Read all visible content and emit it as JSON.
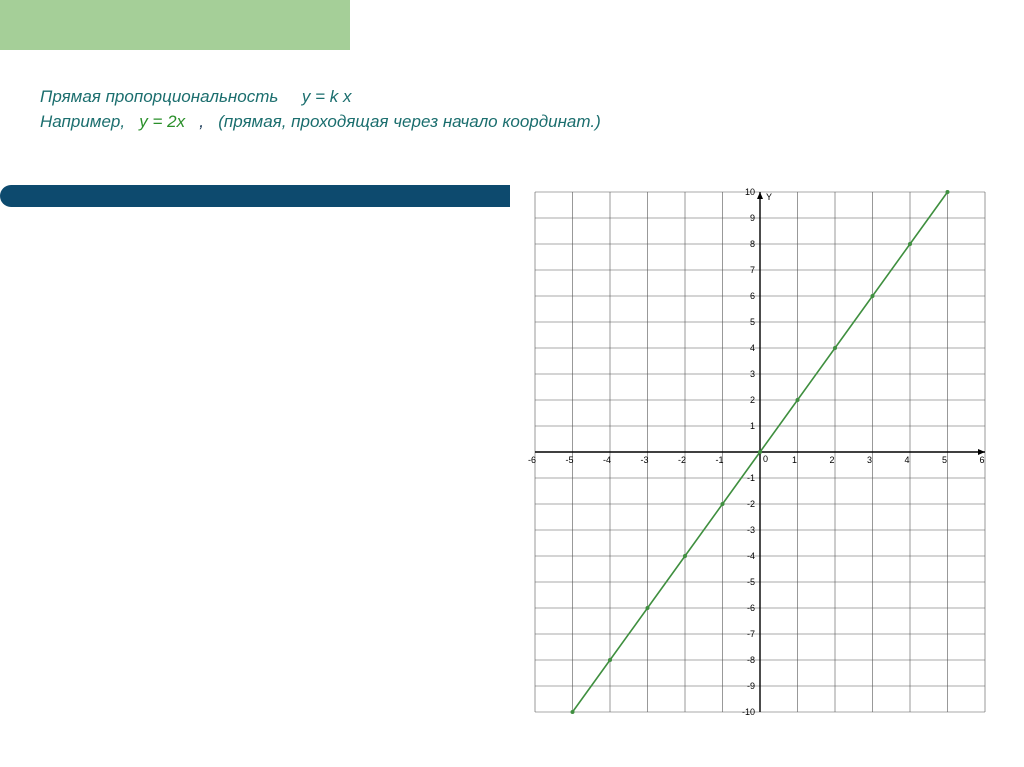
{
  "title": {
    "line1_a": "Прямая пропорциональность",
    "line1_b": "у = k х",
    "line2_a": "Например,",
    "line2_b": "у = 2х",
    "line2_c": ",",
    "line2_d": "(прямая, проходящая через начало  координат.)"
  },
  "chart_data": {
    "type": "line",
    "title": "",
    "xlabel": "",
    "ylabel": "Y",
    "xlim": [
      -6,
      6
    ],
    "ylim": [
      -10,
      10
    ],
    "x_ticks": [
      -6,
      -5,
      -4,
      -3,
      -2,
      -1,
      0,
      1,
      2,
      3,
      4,
      5,
      6
    ],
    "y_ticks": [
      -10,
      -9,
      -8,
      -7,
      -6,
      -5,
      -4,
      -3,
      -2,
      -1,
      1,
      2,
      3,
      4,
      5,
      6,
      7,
      8,
      9,
      10
    ],
    "series": [
      {
        "name": "y = 2x",
        "x": [
          -5,
          -4,
          -3,
          -2,
          -1,
          0,
          1,
          2,
          3,
          4,
          5
        ],
        "y": [
          -10,
          -8,
          -6,
          -4,
          -2,
          0,
          2,
          4,
          6,
          8,
          10
        ]
      }
    ]
  }
}
